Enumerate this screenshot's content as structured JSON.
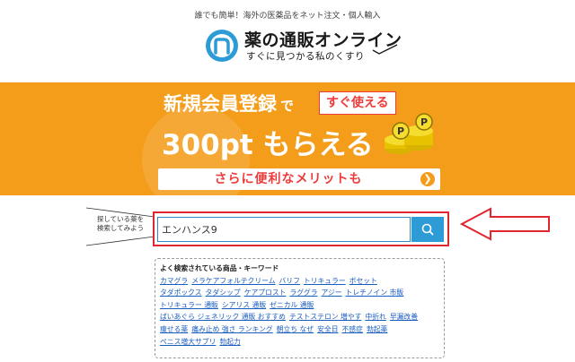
{
  "header": {
    "tagline": "誰でも簡単！海外の医薬品をネット注文・個人輸入",
    "logo_title": "薬の通販オンライン",
    "logo_subtitle": "すぐに見つかる私のくすり"
  },
  "banner": {
    "headline": "新規会員登録",
    "particle": "で",
    "chip": "すぐ使える",
    "big_text": "300pt もらえる",
    "bar_text": "さらに便利なメリットも"
  },
  "search": {
    "hint_line1": "探している薬を",
    "hint_line2": "検索してみよう",
    "value": "エンハンス9",
    "placeholder": ""
  },
  "keywords": {
    "title": "よく検索されている商品・キーワード",
    "rows": [
      [
        "カマグラ",
        "メラケアフォルテクリーム",
        "バリフ",
        "トリキュラー",
        "ボセット"
      ],
      [
        "タダポックス",
        "タダシップ",
        "ケアプロスト",
        "ラググラ",
        "アジー",
        "トレチノイン 市販"
      ],
      [
        "トリキュラー 通販",
        "シアリス 通販",
        "ゼニカル 通販"
      ],
      [
        "ばいあぐら ジェネリック 通販 おすすめ",
        "テストステロン 増やす",
        "中折れ",
        "早漏改善"
      ],
      [
        "痩せる薬",
        "痛み止め 強さ ランキング",
        "朝立ち なぜ",
        "安全日",
        "不感症",
        "勃起薬"
      ],
      [
        "ペニス増大サプリ",
        "勃起力"
      ]
    ]
  },
  "colors": {
    "banner": "#f49d1b",
    "accent_red": "#e2262f",
    "search_button": "#2c9bd6",
    "link": "#1a5dc1"
  },
  "icons": {
    "logo": "logo-n-icon",
    "search": "magnifier-icon",
    "coins": "coins-icon",
    "bar": "chevron-right-icon"
  }
}
